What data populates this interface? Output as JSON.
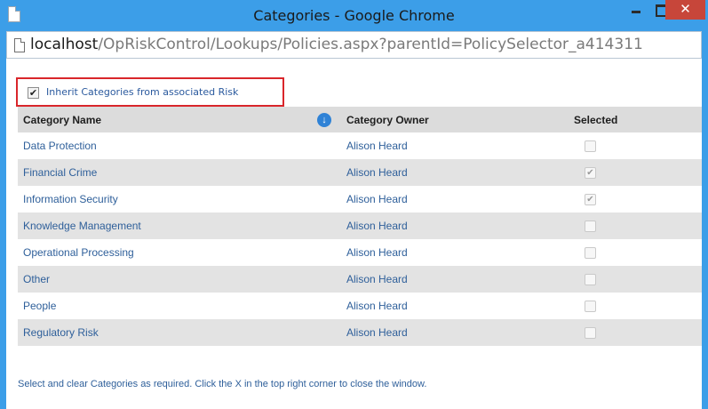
{
  "window": {
    "title": "Categories - Google Chrome",
    "close_glyph": "✕",
    "page_icon": "page-icon",
    "frame_color": "#3c9ee8",
    "close_color": "#c7463a"
  },
  "address_bar": {
    "host": "localhost",
    "path": "/OpRiskControl/Lookups/Policies.aspx?parentId=PolicySelector_a414311"
  },
  "inherit": {
    "label": "Inherit Categories from associated Risk",
    "checked": true,
    "check_glyph": "✔",
    "highlight_color": "#d9262b"
  },
  "table": {
    "headers": {
      "name": "Category Name",
      "owner": "Category Owner",
      "selected": "Selected"
    },
    "sort_glyph": "↓",
    "check_glyph": "✔",
    "rows": [
      {
        "name": "Data Protection",
        "owner": "Alison Heard",
        "selected": false
      },
      {
        "name": "Financial Crime",
        "owner": "Alison Heard",
        "selected": true
      },
      {
        "name": "Information Security",
        "owner": "Alison Heard",
        "selected": true
      },
      {
        "name": "Knowledge Management",
        "owner": "Alison Heard",
        "selected": false
      },
      {
        "name": "Operational Processing",
        "owner": "Alison Heard",
        "selected": false
      },
      {
        "name": "Other",
        "owner": "Alison Heard",
        "selected": false
      },
      {
        "name": "People",
        "owner": "Alison Heard",
        "selected": false
      },
      {
        "name": "Regulatory Risk",
        "owner": "Alison Heard",
        "selected": false
      }
    ]
  },
  "footer_note": "Select and clear Categories as required. Click the X in the top right corner to close the window."
}
